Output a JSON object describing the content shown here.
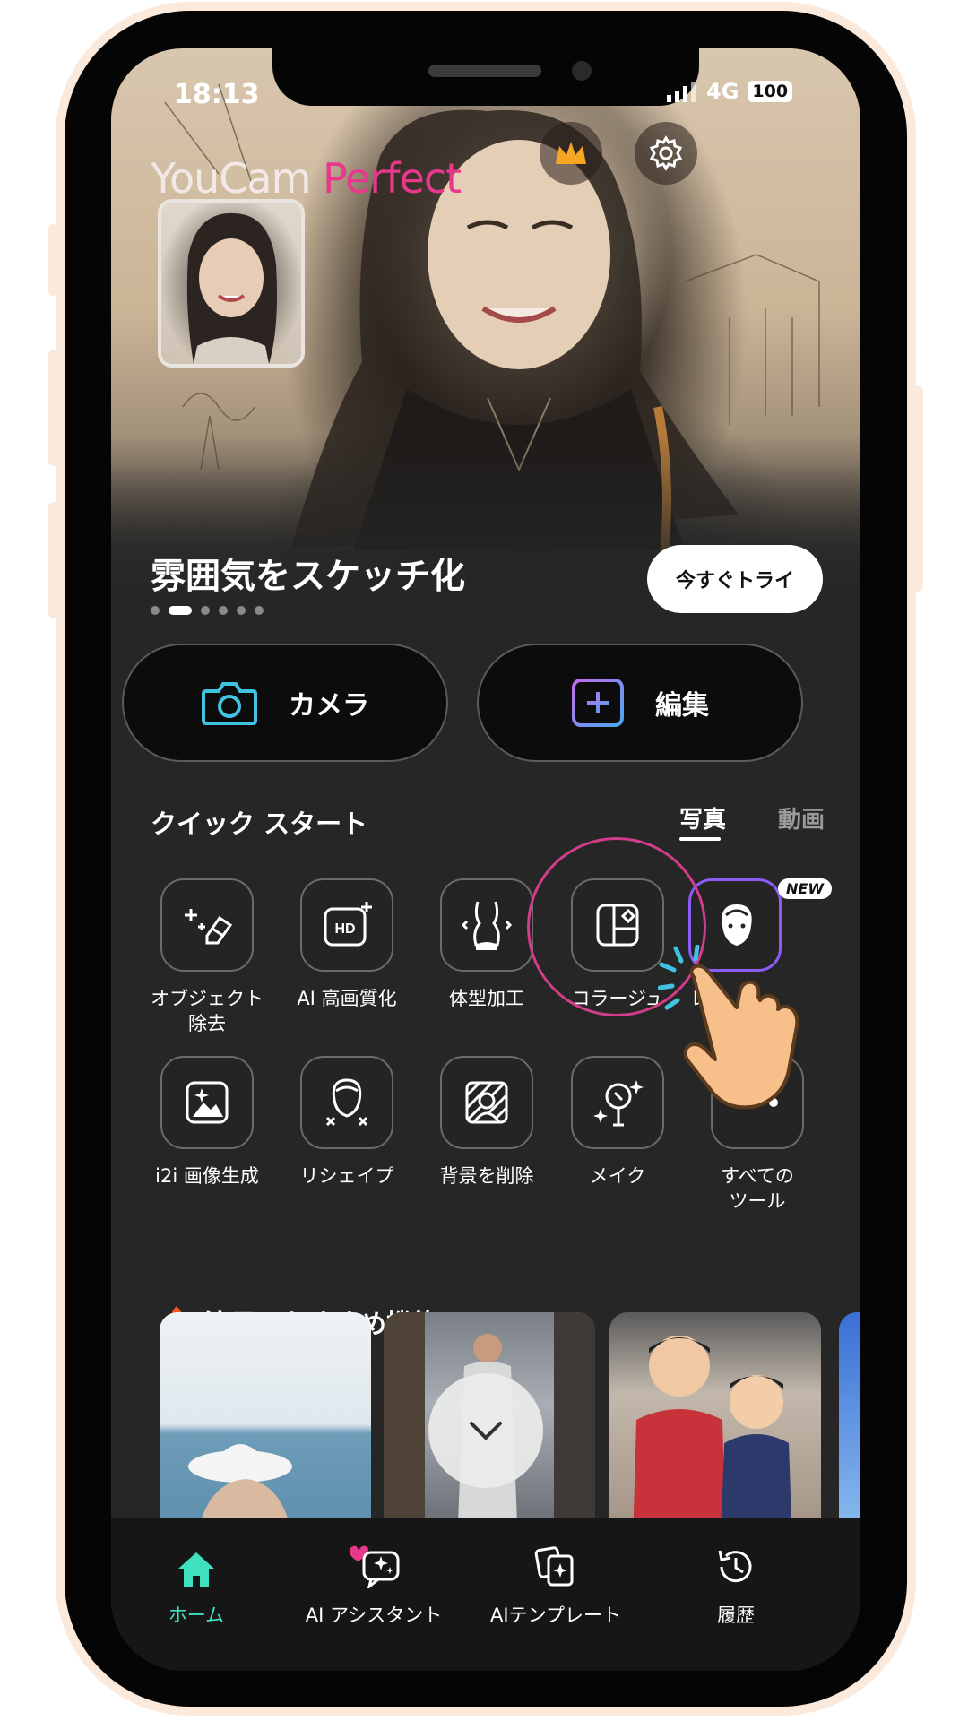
{
  "status_bar": {
    "time": "18:13",
    "network": "4G",
    "battery": "100"
  },
  "hero": {
    "logo_part1": "YouCam",
    "logo_part2": "Perfect",
    "title": "雰囲気をスケッチ化",
    "try_button": "今すぐトライ",
    "page_count": 6,
    "active_page": 1
  },
  "actions": {
    "camera": "カメラ",
    "edit": "編集"
  },
  "quick_start": {
    "title": "クイック スタート",
    "tabs": [
      {
        "label": "写真",
        "active": true
      },
      {
        "label": "動画",
        "active": false
      }
    ],
    "tools": [
      {
        "label": "オブジェクト\n除去",
        "icon": "eraser-sparkle-icon"
      },
      {
        "label": "AI 高画質化",
        "icon": "hd-icon"
      },
      {
        "label": "体型加工",
        "icon": "body-shape-icon"
      },
      {
        "label": "コラージュ",
        "icon": "collage-icon"
      },
      {
        "label": "レタ",
        "icon": "face-retouch-icon",
        "badge": "NEW"
      },
      {
        "label": "i2i 画像生成",
        "icon": "image-generate-icon"
      },
      {
        "label": "リシェイプ",
        "icon": "reshape-icon"
      },
      {
        "label": "背景を削除",
        "icon": "background-remove-icon"
      },
      {
        "label": "メイク",
        "icon": "makeup-mirror-icon"
      },
      {
        "label": "すべての\nツール",
        "icon": "more-dots-icon"
      }
    ]
  },
  "featured": {
    "title": "注目のおすすめ機能",
    "icon": "fire-icon"
  },
  "bottom_nav": [
    {
      "label": "ホーム",
      "icon": "home-icon",
      "active": true
    },
    {
      "label": "AI アシスタント",
      "icon": "ai-assistant-icon",
      "active": false
    },
    {
      "label": "AIテンプレート",
      "icon": "ai-template-icon",
      "active": false
    },
    {
      "label": "履歴",
      "icon": "history-icon",
      "active": false
    }
  ],
  "colors": {
    "accent_pink": "#e8388c",
    "nav_active": "#3ee0c0",
    "camera_teal": "#3fc3e0",
    "edit_purple": "#9b6cf0",
    "highlight_ring": "#d23d8a"
  }
}
